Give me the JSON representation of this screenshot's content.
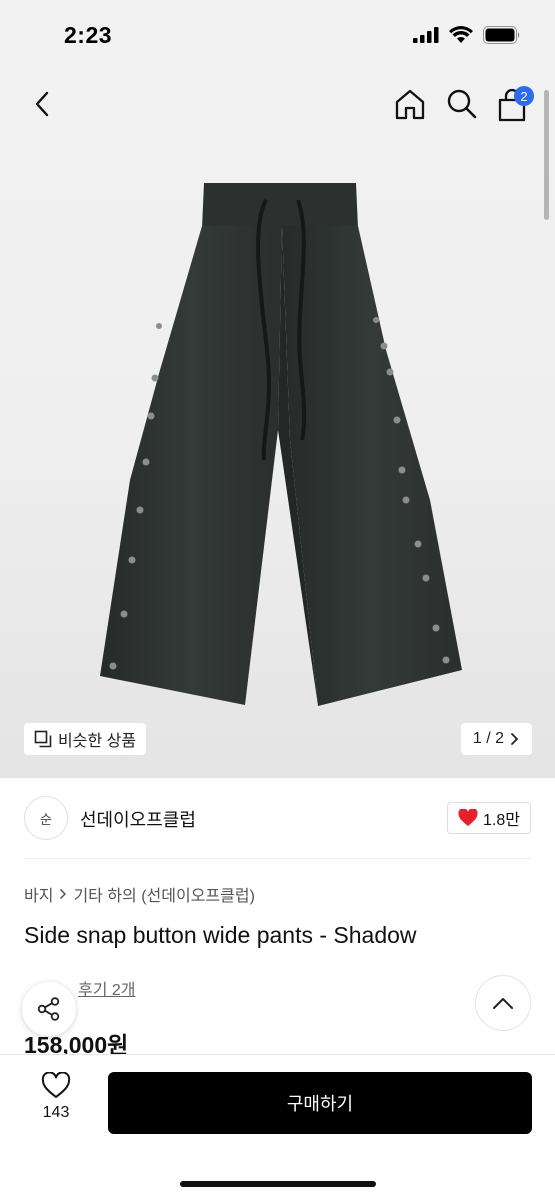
{
  "status": {
    "time": "2:23"
  },
  "nav": {
    "cart_count": "2"
  },
  "hero": {
    "similar_label": "비슷한 상품",
    "pager": "1 / 2"
  },
  "brand": {
    "logo_text": "순",
    "name": "선데이오프클럽",
    "likes": "1.8만"
  },
  "breadcrumb": {
    "category": "바지",
    "subcategory": "기타 하의 (선데이오프클럽)"
  },
  "product": {
    "title": "Side snap button wide pants - Shadow",
    "review_link": "후기 2개",
    "price": "158,000원"
  },
  "bottom": {
    "wish_count": "143",
    "buy_label": "구매하기"
  },
  "colors": {
    "accent_badge": "#2d6cf0",
    "heart": "#e8202a",
    "product_fabric": "#2f3533",
    "buy_button": "#000000"
  }
}
